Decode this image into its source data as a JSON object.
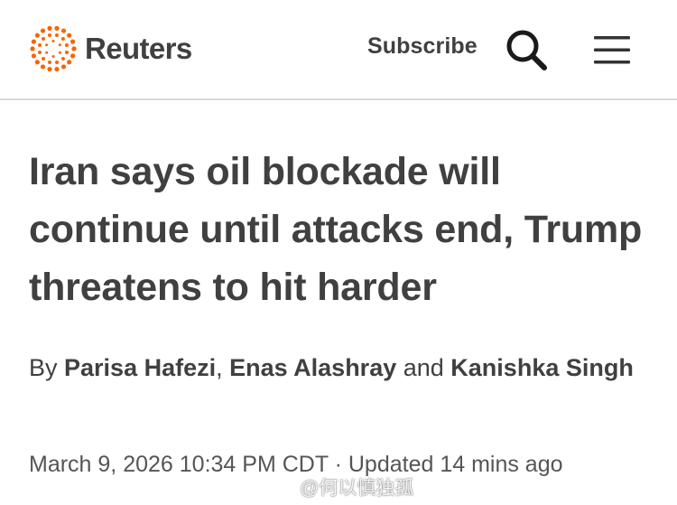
{
  "header": {
    "brand": "Reuters",
    "brand_color": "#FA6400",
    "subscribe_label": "Subscribe",
    "search_icon": "search-icon",
    "menu_icon": "hamburger-menu-icon"
  },
  "article": {
    "headline": "Iran says oil blockade will continue until attacks end, Trump threatens to hit harder",
    "byline": {
      "prefix": "By ",
      "authors": [
        "Parisa Hafezi",
        "Enas Alashray",
        "Kanishka Singh"
      ],
      "separator": ", ",
      "conjunction": " and "
    },
    "dateline": {
      "published": "March 9, 2026 10:34 PM CDT",
      "separator": " · ",
      "updated": "Updated 14 mins ago"
    }
  },
  "watermark": {
    "icon": "weibo-logo-icon",
    "text": "@何以慎独孤"
  }
}
